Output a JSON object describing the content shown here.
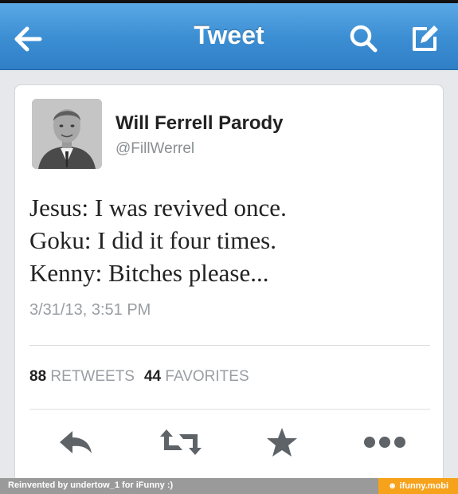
{
  "nav": {
    "title": "Tweet",
    "back_icon": "back-arrow-icon",
    "search_icon": "search-icon",
    "compose_icon": "compose-icon",
    "bar_color": "#3d8fd4"
  },
  "tweet": {
    "author_name": "Will Ferrell Parody",
    "author_handle": "@FillWerrel",
    "lines": [
      "Jesus: I was revived once.",
      "Goku: I did it four times.",
      "Kenny: Bitches please..."
    ],
    "timestamp": "3/31/13, 3:51 PM",
    "retweets_count": "88",
    "retweets_label": "RETWEETS",
    "favorites_count": "44",
    "favorites_label": "FAVORITES"
  },
  "actions": [
    {
      "icon": "reply-icon"
    },
    {
      "icon": "retweet-icon"
    },
    {
      "icon": "favorite-star-icon"
    },
    {
      "icon": "more-dots-icon"
    }
  ],
  "footer": {
    "credit": "Reinvented by undertow_1 for iFunny :)",
    "badge": "☻ ifunny.mobi",
    "badge_color": "#f7a21b"
  }
}
